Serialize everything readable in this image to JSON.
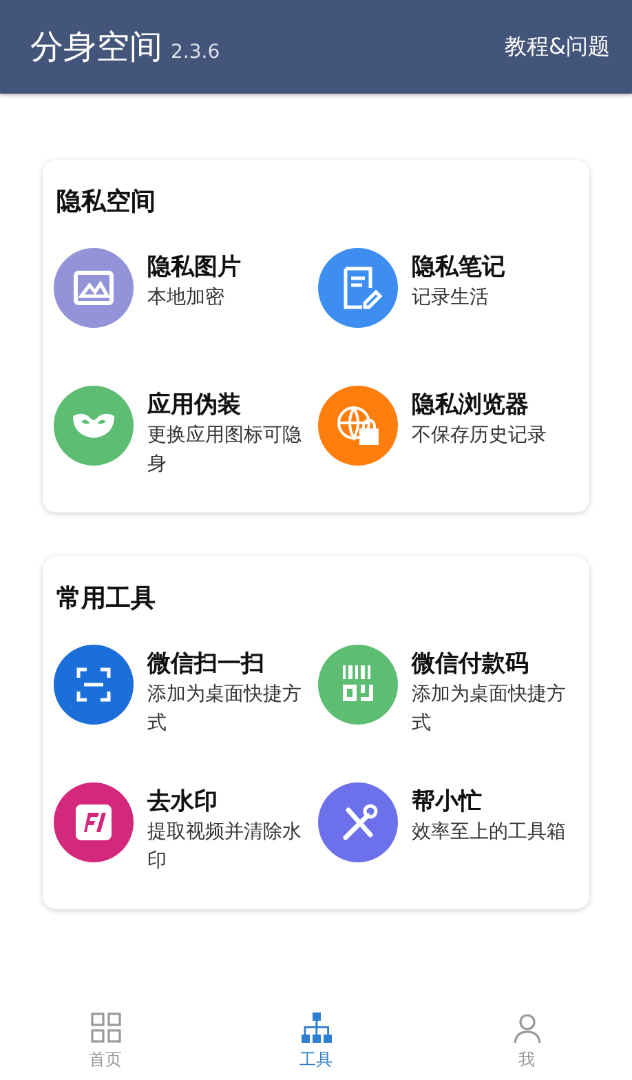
{
  "header": {
    "title": "分身空间",
    "version": "2.3.6",
    "action": "教程&问题"
  },
  "sections": [
    {
      "title": "隐私空间",
      "items": [
        {
          "title": "隐私图片",
          "subtitle": "本地加密",
          "color": "#9393d9"
        },
        {
          "title": "隐私笔记",
          "subtitle": "记录生活",
          "color": "#3d8ef0"
        },
        {
          "title": "应用伪装",
          "subtitle": "更换应用图标可隐身",
          "color": "#5dbd72"
        },
        {
          "title": "隐私浏览器",
          "subtitle": "不保存历史记录",
          "color": "#fd7e0d"
        }
      ]
    },
    {
      "title": "常用工具",
      "items": [
        {
          "title": "微信扫一扫",
          "subtitle": "添加为桌面快捷方式",
          "color": "#1c6fd8"
        },
        {
          "title": "微信付款码",
          "subtitle": "添加为桌面快捷方式",
          "color": "#5dbd72"
        },
        {
          "title": "去水印",
          "subtitle": "提取视频并清除水印",
          "color": "#d4287c"
        },
        {
          "title": "帮小忙",
          "subtitle": "效率至上的工具箱",
          "color": "#6c70ea"
        }
      ]
    }
  ],
  "tabs": [
    {
      "label": "首页",
      "selected": false
    },
    {
      "label": "工具",
      "selected": true
    },
    {
      "label": "我",
      "selected": false
    }
  ]
}
